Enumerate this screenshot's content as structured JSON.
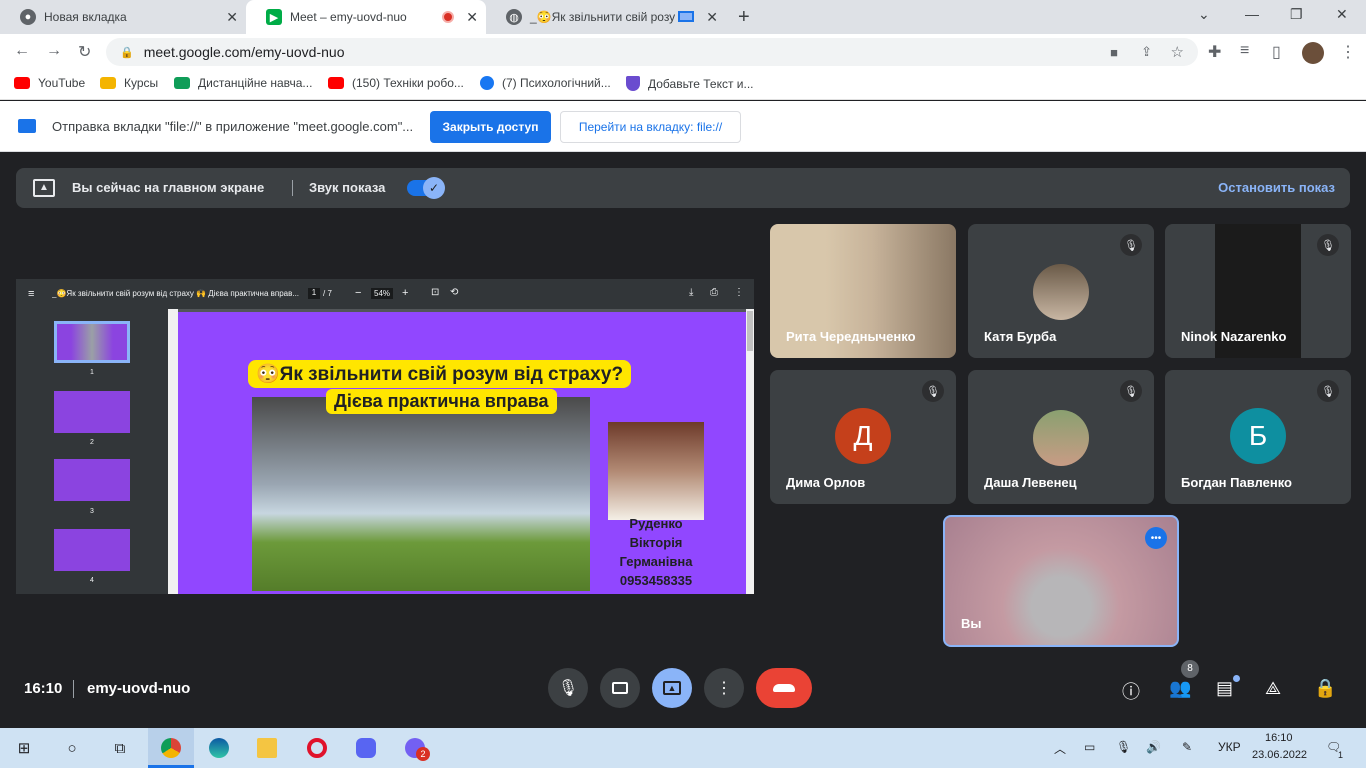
{
  "tabs": [
    {
      "title": "Новая вкладка",
      "icon": "chrome-icon"
    },
    {
      "title": "Meet – emy-uovd-nuo",
      "icon": "meet-icon"
    },
    {
      "title": "_😳Як звільнити свій розу",
      "icon": "globe-icon"
    }
  ],
  "address": {
    "url": "meet.google.com/emy-uovd-nuo"
  },
  "bookmarks": [
    {
      "label": "YouTube",
      "color": "#ff0000"
    },
    {
      "label": "Курсы",
      "color": "#f4b400"
    },
    {
      "label": "Дистанційне навча...",
      "color": "#0f9d58"
    },
    {
      "label": "(150) Техніки робо...",
      "color": "#ff0000"
    },
    {
      "label": "(7) Психологічний...",
      "color": "#1877f2"
    },
    {
      "label": "Добавьте Текст и...",
      "color": "#6a4ccf"
    }
  ],
  "infobar": {
    "text": "Отправка вкладки \"file://\" в приложение \"meet.google.com\"...",
    "primary": "Закрыть доступ",
    "secondary": "Перейти на вкладку: file://"
  },
  "presenting": {
    "label": "Вы сейчас на главном экране",
    "audio": "Звук показа",
    "stop": "Остановить показ"
  },
  "pdf": {
    "title": "_😳Як звільнити свій розум від страху 🙌 Дієва практична вправ...",
    "page": "1",
    "total": "/ 7",
    "zoom": "54%",
    "thumbs": [
      "1",
      "2",
      "3",
      "4"
    ]
  },
  "slide": {
    "title": "😳Як звільнити свій розум від страху?",
    "subtitle": "Дієва практична вправа",
    "name1": "Руденко",
    "name2": "Вікторія",
    "name3": "Германівна",
    "phone": "0953458335"
  },
  "participants": [
    {
      "name": "Рита Чередныченко"
    },
    {
      "name": "Катя Бурба"
    },
    {
      "name": "Ninok Nazarenko"
    },
    {
      "name": "Дима Орлов",
      "initial": "Д",
      "color": "#c5401b"
    },
    {
      "name": "Даша Левенец"
    },
    {
      "name": "Богдан Павленко",
      "initial": "Б",
      "color": "#0e8fa0"
    },
    {
      "name": "Вы"
    }
  ],
  "meeting": {
    "time": "16:10",
    "code": "emy-uovd-nuo",
    "people_count": "8"
  },
  "taskbar": {
    "lang": "УКР",
    "time": "16:10",
    "date": "23.06.2022",
    "viber_badge": "2",
    "notif": "1"
  }
}
